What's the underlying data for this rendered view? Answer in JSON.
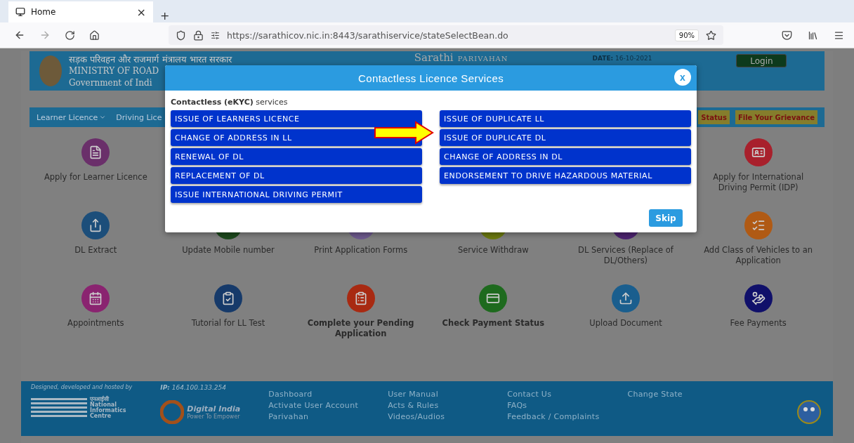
{
  "browser": {
    "tab": {
      "title": "Home",
      "close": "×",
      "selected": true
    },
    "new_tab": "+",
    "url": "https://sarathicov.nic.in:8443/sarathiservice/stateSelectBean.do",
    "zoom": "90%"
  },
  "header": {
    "hindi": "सड़क परिवहन और राजमार्ग मंत्रालय भारत सरकार",
    "ministry": "MINISTRY OF ROAD",
    "government": "Government of Indi",
    "logo_word": "Sarathi",
    "logo_sub": "PARIVAHAN",
    "date": "**DATE:** 16-10-2021",
    "login": "Login"
  },
  "nav": {
    "left": [
      {
        "label": "Learner Licence",
        "caret": true
      },
      {
        "label": "Driving Lice",
        "caret": false
      }
    ],
    "right": [
      "Status",
      "File Your Grievance"
    ]
  },
  "tile_rows": [
    {
      "items": [
        {
          "label": "Apply for Learner Licence",
          "color": "#6a2f6a",
          "bold": false
        },
        {
          "label": "Apply for International Driving Permit (IDP)",
          "color": "#a8202c",
          "bold": false
        }
      ]
    },
    {
      "items": [
        {
          "label": "DL Extract",
          "color": "#1c4e7a",
          "bold": false
        },
        {
          "label": "Update Mobile number",
          "color": "#1d4a1d",
          "bold": false
        },
        {
          "label": "Print Application Forms",
          "color": "#6e5a8e",
          "bold": false
        },
        {
          "label": "Service Withdraw",
          "color": "#6c7a10",
          "bold": false
        },
        {
          "label": "DL Services (Replace of DL/Others)",
          "color": "#4d2470",
          "bold": false
        },
        {
          "label": "Add Class of Vehicles to an Application",
          "color": "#b05a14",
          "bold": false
        }
      ]
    },
    {
      "items": [
        {
          "label": "Appointments",
          "color": "#8a2470",
          "bold": false
        },
        {
          "label": "Tutorial for LL Test",
          "color": "#163a6a",
          "bold": false
        },
        {
          "label": "Complete your Pending Application",
          "color": "#a82a12",
          "bold": true
        },
        {
          "label": "Check Payment Status",
          "color": "#1e6a1e",
          "bold": true
        },
        {
          "label": "Upload Document",
          "color": "#1a5e8e",
          "bold": false
        },
        {
          "label": "Fee Payments",
          "color": "#10106a",
          "bold": false
        }
      ]
    }
  ],
  "footer": {
    "credit": "Designed, developed and hosted by",
    "nic": [
      "एनआईसी",
      "National",
      "Informatics",
      "Centre"
    ],
    "ip": "**IP:** 164.100.133.254",
    "digital_india": "Digital India",
    "digital_tag": "Power To Empower",
    "columns": [
      [
        "Dashboard",
        "Activate User Account",
        "Parivahan"
      ],
      [
        "User Manual",
        "Acts & Rules",
        "Videos/Audios"
      ],
      [
        "Contact Us",
        "FAQs",
        "Feedback / Complaints"
      ],
      [
        "Change State"
      ]
    ]
  },
  "modal": {
    "title": "Contactless Licence Services",
    "close": "x",
    "subtitle": "**Contactless (eKYC)** services",
    "left": [
      "ISSUE OF LEARNERS LICENCE",
      "CHANGE OF ADDRESS IN LL",
      "RENEWAL OF DL",
      "REPLACEMENT OF DL",
      "ISSUE INTERNATIONAL DRIVING PERMIT"
    ],
    "right": [
      "ISSUE OF DUPLICATE LL",
      "ISSUE OF DUPLICATE DL",
      "CHANGE OF ADDRESS IN DL",
      "ENDORSEMENT TO DRIVE HAZARDOUS MATERIAL"
    ],
    "skip": "Skip"
  }
}
